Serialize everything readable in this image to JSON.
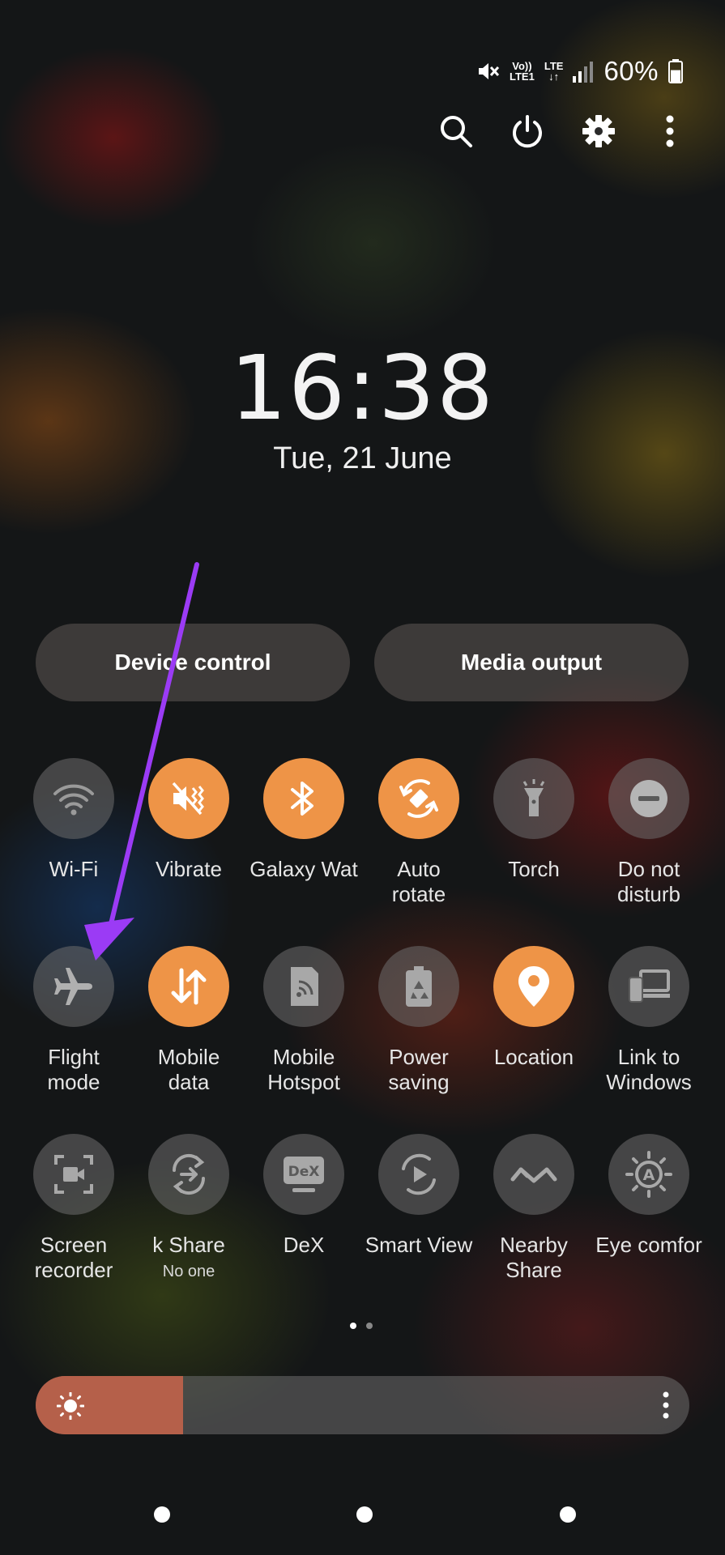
{
  "status_bar": {
    "volte_label": "Vo))",
    "lte1_label": "LTE1",
    "lte_label": "LTE",
    "battery_percent": "60%",
    "battery_level": 0.6
  },
  "toolbar": {
    "icons": [
      "search-icon",
      "power-icon",
      "settings-gear-icon",
      "more-vertical-icon"
    ]
  },
  "clock": {
    "time": "16:38",
    "date": "Tue, 21 June"
  },
  "pills": {
    "device_control": "Device control",
    "media_output": "Media output"
  },
  "tiles": {
    "wifi": {
      "label": "Wi-Fi",
      "on": false
    },
    "vibrate": {
      "label": "Vibrate",
      "on": true
    },
    "galaxy_watch": {
      "label": "Galaxy Wat",
      "on": true
    },
    "auto_rotate": {
      "label1": "Auto",
      "label2": "rotate",
      "on": true
    },
    "torch": {
      "label": "Torch",
      "on": false
    },
    "dnd": {
      "label1": "Do not",
      "label2": "disturb",
      "on": false
    },
    "flight_mode": {
      "label1": "Flight",
      "label2": "mode",
      "on": false
    },
    "mobile_data": {
      "label1": "Mobile",
      "label2": "data",
      "on": true
    },
    "mobile_hotspot": {
      "label1": "Mobile",
      "label2": "Hotspot",
      "on": false
    },
    "power_saving": {
      "label1": "Power",
      "label2": "saving",
      "on": false
    },
    "location": {
      "label": "Location",
      "on": true
    },
    "link_to_windows": {
      "label1": "Link to",
      "label2": "Windows",
      "on": false
    },
    "screen_recorder": {
      "label1": "Screen",
      "label2": "recorder",
      "on": false
    },
    "quick_share": {
      "label": "k Share",
      "sub": "No one",
      "on": false
    },
    "dex": {
      "label": "DeX",
      "icon_text": "DeX",
      "on": false
    },
    "smart_view": {
      "label": "Smart View",
      "on": false
    },
    "nearby_share": {
      "label1": "Nearby",
      "label2": "Share",
      "on": false
    },
    "eye_comfort": {
      "label": "Eye comfor",
      "icon_text": "A",
      "on": false
    }
  },
  "brightness": {
    "level": 0.225
  },
  "colors": {
    "tile_active": "#ee9447",
    "brightness_fill": "#b5604a",
    "annotation_arrow": "#9b3bf5"
  }
}
